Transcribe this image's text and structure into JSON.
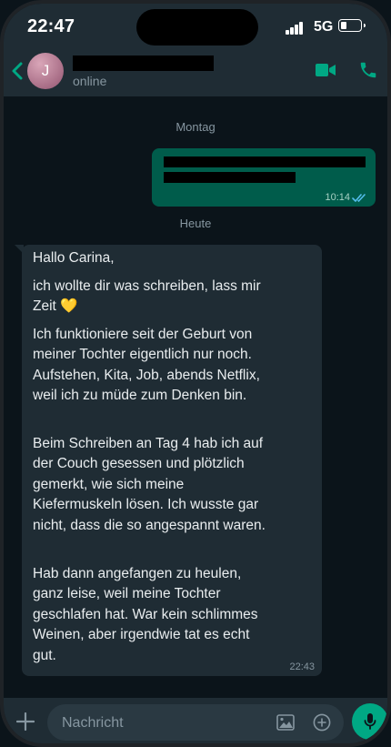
{
  "status_bar": {
    "time": "22:47",
    "network": "5G",
    "battery_level": 0.25
  },
  "header": {
    "avatar_initial": "J",
    "contact_name": "[redacted]",
    "contact_status": "online"
  },
  "chat": {
    "day_label_1": "Montag",
    "outgoing": {
      "text": "[redacted]",
      "time": "10:14",
      "status": "read"
    },
    "day_label_2": "Heute",
    "incoming": {
      "paragraphs": [
        "Hallo Carina,",
        "ich wollte dir was schreiben, lass mir Zeit 💛",
        "Ich funktioniere seit der Geburt von meiner Tochter eigentlich nur noch. Aufstehen, Kita, Job, abends Netflix, weil ich zu müde zum Denken bin.",
        "Beim Schreiben an Tag 4 hab ich auf der Couch gesessen und plötzlich gemerkt, wie sich meine Kiefermuskeln lösen. Ich wusste gar nicht, dass die so angespannt waren.",
        "Hab dann angefangen zu heulen, ganz leise, weil meine Tochter geschlafen hat. War kein schlimmes Weinen, aber irgendwie tat es echt gut."
      ],
      "time": "22:43"
    }
  },
  "input": {
    "placeholder": "Nachricht"
  },
  "colors": {
    "accent": "#00a884",
    "outgoing_bubble": "#005c4b",
    "incoming_bubble": "#1f2c34",
    "background": "#0b141a"
  }
}
